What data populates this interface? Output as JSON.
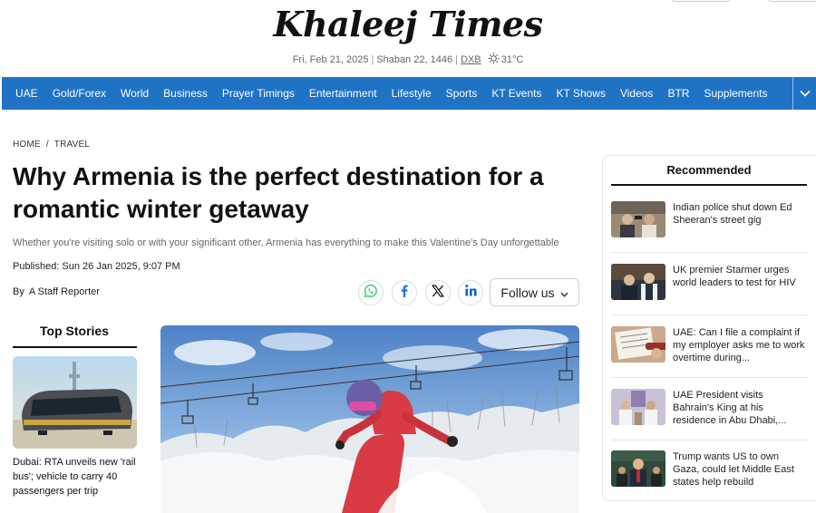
{
  "masthead": {
    "logo": "Khaleej Times",
    "date": "Fri, Feb 21, 2025",
    "hijri_date": "Shaban 22, 1446",
    "city": "DXB",
    "temperature": "31°C",
    "weather_icon": "sun-icon"
  },
  "nav": {
    "items": [
      "UAE",
      "Gold/Forex",
      "World",
      "Business",
      "Prayer Timings",
      "Entertainment",
      "Lifestyle",
      "Sports",
      "KT Events",
      "KT Shows",
      "Videos",
      "BTR",
      "Supplements"
    ],
    "more_icon": "chevron-down-icon"
  },
  "breadcrumb": {
    "home": "HOME",
    "separator": "/",
    "section": "TRAVEL"
  },
  "article": {
    "headline": "Why Armenia is the perfect destination for a romantic winter getaway",
    "subheadline": "Whether you're visiting solo or with your significant other, Armenia has everything to make this Valentine's Day unforgettable",
    "published": "Published: Sun 26 Jan 2025, 9:07 PM",
    "by": "By",
    "author": "A Staff Reporter",
    "follow_label": "Follow us",
    "share_icons": [
      "whatsapp-icon",
      "facebook-icon",
      "x-icon",
      "linkedin-icon"
    ]
  },
  "top_stories": {
    "title": "Top Stories",
    "items": [
      {
        "text": "Dubai: RTA unveils new 'rail bus'; vehicle to carry 40 passengers per trip"
      }
    ]
  },
  "recommended": {
    "title": "Recommended",
    "items": [
      {
        "text": "Indian police shut down Ed Sheeran's street gig"
      },
      {
        "text": "UK premier Starmer urges world leaders to test for HIV"
      },
      {
        "text": "UAE: Can I file a complaint if my employer asks me to work overtime during..."
      },
      {
        "text": "UAE President visits Bahrain's King at his residence in Abu Dhabi,..."
      },
      {
        "text": "Trump wants US to own Gaza, could let Middle East states help rebuild"
      }
    ]
  },
  "colors": {
    "nav_bg": "#1f73c4",
    "whatsapp": "#25d366",
    "facebook": "#1877f2",
    "linkedin": "#0a66c2"
  }
}
